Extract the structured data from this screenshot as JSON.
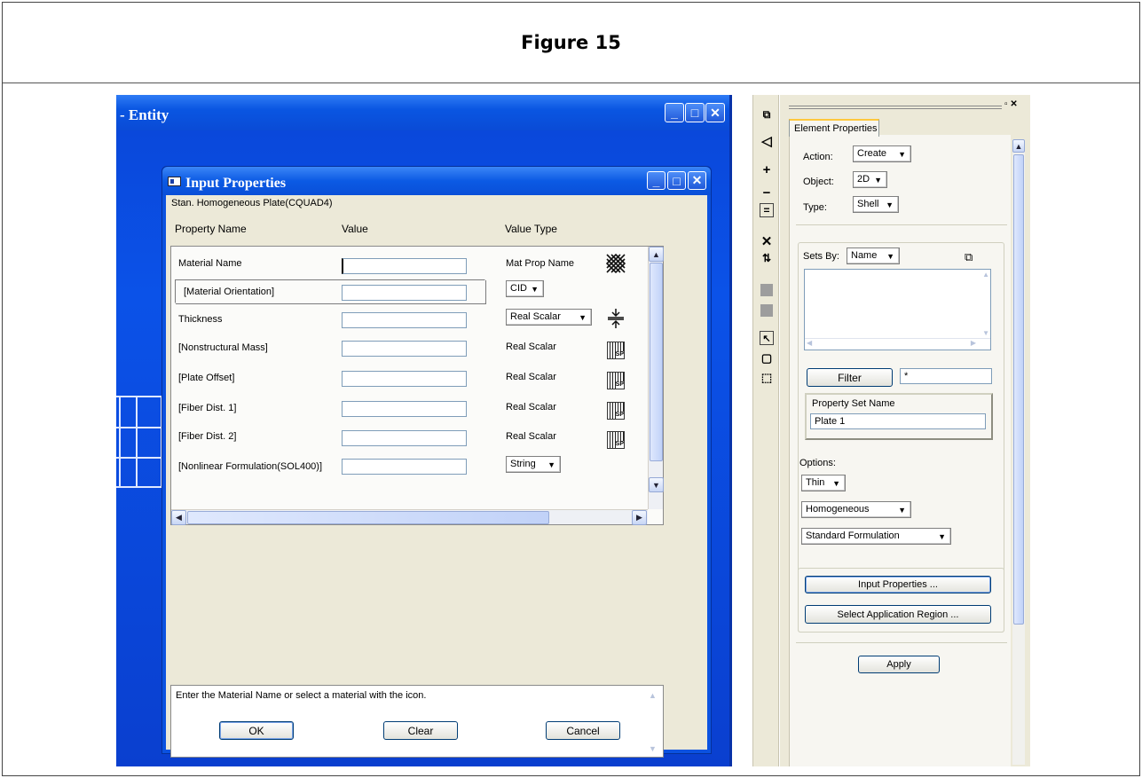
{
  "figure_title": "Figure 15",
  "entity_window": {
    "title": "- Entity"
  },
  "dialog": {
    "title": "Input Properties",
    "subtitle": "Stan. Homogeneous Plate(CQUAD4)",
    "headers": {
      "property_name": "Property Name",
      "value": "Value",
      "value_type": "Value Type"
    },
    "properties": [
      {
        "name": "Material Name",
        "value": "",
        "value_type": "Mat Prop Name",
        "icon": "material-pattern-icon"
      },
      {
        "name": "[Material Orientation]",
        "value": "",
        "value_type": "CID",
        "dropdown": true
      },
      {
        "name": "Thickness",
        "value": "",
        "value_type": "Real Scalar",
        "dropdown": true,
        "icon": "thickness-arrows-icon"
      },
      {
        "name": "[Nonstructural Mass]",
        "value": "",
        "value_type": "Real Scalar",
        "icon": "spatial-field-icon"
      },
      {
        "name": "[Plate Offset]",
        "value": "",
        "value_type": "Real Scalar",
        "icon": "spatial-field-icon"
      },
      {
        "name": "[Fiber Dist. 1]",
        "value": "",
        "value_type": "Real Scalar",
        "icon": "spatial-field-icon"
      },
      {
        "name": "[Fiber Dist. 2]",
        "value": "",
        "value_type": "Real Scalar",
        "icon": "spatial-field-icon"
      },
      {
        "name": "[Nonlinear Formulation(SOL400)]",
        "value": "",
        "value_type": "String",
        "dropdown": true
      }
    ],
    "help_text": "Enter the Material Name or select a material with the icon.",
    "buttons": {
      "ok": "OK",
      "clear": "Clear",
      "cancel": "Cancel"
    }
  },
  "element_properties": {
    "tab_label": "Element Properties",
    "action_label": "Action:",
    "action_value": "Create",
    "object_label": "Object:",
    "object_value": "2D",
    "type_label": "Type:",
    "type_value": "Shell",
    "sets_by_label": "Sets By:",
    "sets_by_value": "Name",
    "filter_button": "Filter",
    "filter_value": "*",
    "property_set_name_label": "Property Set Name",
    "property_set_name_value": "Plate 1",
    "options_label": "Options:",
    "option_thin": "Thin",
    "option_homogeneous": "Homogeneous",
    "option_formulation": "Standard Formulation",
    "input_properties_button": "Input Properties ...",
    "select_region_button": "Select Application Region ...",
    "apply_button": "Apply"
  }
}
